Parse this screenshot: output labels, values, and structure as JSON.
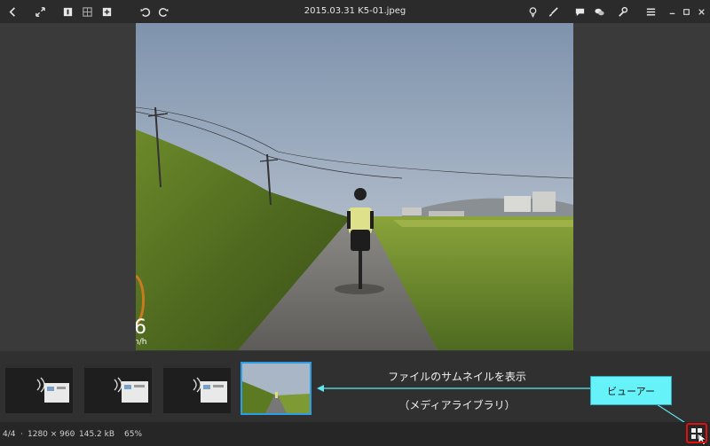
{
  "window": {
    "title": "2015.03.31 K5-01.jpeg"
  },
  "toolbar": {
    "left_icons": [
      "back-arrow-icon",
      "fullscreen-icon",
      "single-view-icon",
      "grid-view-icon",
      "add-icon"
    ],
    "history_icons": [
      "undo-icon",
      "redo-icon"
    ],
    "right_icons": [
      "location-pin-icon",
      "brush-icon",
      "comment-icon",
      "chat-icon",
      "wrench-icon",
      "menu-icon"
    ],
    "window_controls": [
      "minimize-icon",
      "maximize-icon",
      "close-icon"
    ]
  },
  "filmstrip": {
    "caption_line1": "ファイルのサムネイルを表示",
    "caption_line2": "（メディアライブラリ）",
    "thumbnails": [
      "screenshot",
      "screenshot",
      "screenshot",
      "photo"
    ],
    "selected_index": 3
  },
  "status": {
    "position": "4/4",
    "dimensions": "1280 × 960",
    "file_size": "145.2 kB",
    "zoom": "65%"
  },
  "annotation": {
    "callout_label": "ビューアー",
    "callout_color": "#66f2f9",
    "highlight_color": "#e01010"
  },
  "photo_overlay": {
    "speed_text": "6",
    "unit_text": "n/h"
  }
}
